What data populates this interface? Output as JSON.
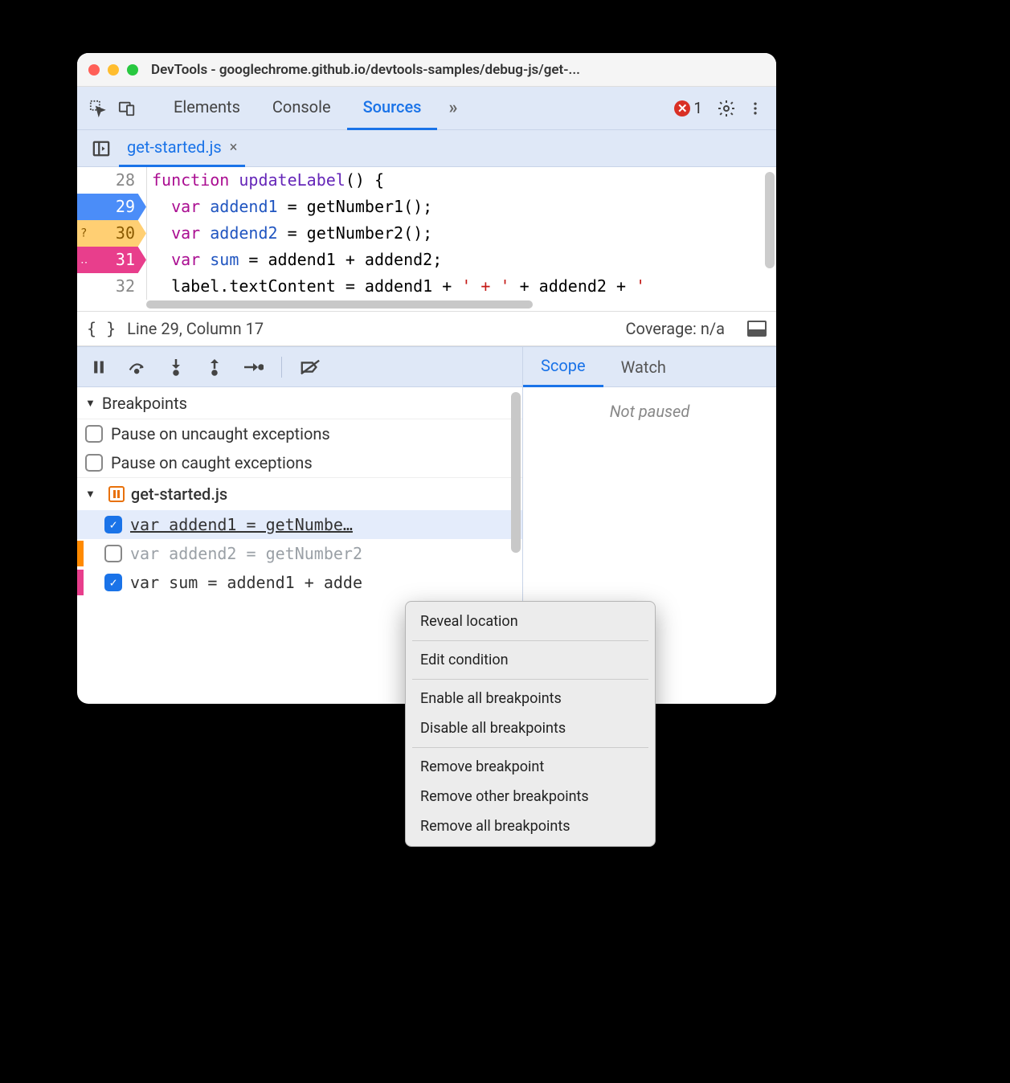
{
  "window": {
    "title": "DevTools - googlechrome.github.io/devtools-samples/debug-js/get-..."
  },
  "toolbar": {
    "tabs": [
      "Elements",
      "Console",
      "Sources"
    ],
    "active_tab": "Sources",
    "overflow": "»",
    "error_count": "1"
  },
  "file_tab": {
    "name": "get-started.js",
    "close": "×"
  },
  "code": {
    "lines": [
      {
        "num": "28",
        "bp": null,
        "indicator": "",
        "tokens": [
          [
            "kw",
            "function "
          ],
          [
            "fn",
            "updateLabel"
          ],
          [
            "",
            "() {"
          ]
        ]
      },
      {
        "num": "29",
        "bp": "blue",
        "indicator": "",
        "tokens": [
          [
            "",
            "  "
          ],
          [
            "kw",
            "var "
          ],
          [
            "varname",
            "addend1"
          ],
          [
            "",
            " = getNumber1();"
          ]
        ]
      },
      {
        "num": "30",
        "bp": "orange",
        "indicator": "?",
        "tokens": [
          [
            "",
            "  "
          ],
          [
            "kw",
            "var "
          ],
          [
            "varname",
            "addend2"
          ],
          [
            "",
            " = getNumber2();"
          ]
        ]
      },
      {
        "num": "31",
        "bp": "pink",
        "indicator": "‥",
        "tokens": [
          [
            "",
            "  "
          ],
          [
            "kw",
            "var "
          ],
          [
            "varname",
            "sum"
          ],
          [
            "",
            " = addend1 + addend2;"
          ]
        ]
      },
      {
        "num": "32",
        "bp": null,
        "indicator": "",
        "tokens": [
          [
            "",
            "  label.textContent = addend1 + "
          ],
          [
            "str",
            "' + '"
          ],
          [
            "",
            " + addend2 + "
          ],
          [
            "str",
            "'"
          ]
        ]
      }
    ]
  },
  "status": {
    "position": "Line 29, Column 17",
    "coverage": "Coverage: n/a"
  },
  "breakpoints": {
    "header": "Breakpoints",
    "pause_uncaught": "Pause on uncaught exceptions",
    "pause_caught": "Pause on caught exceptions",
    "file": "get-started.js",
    "items": [
      {
        "checked": true,
        "text": "var addend1 = getNumbe…",
        "stripe": null,
        "selected": true,
        "disabled": false
      },
      {
        "checked": false,
        "text": "var addend2 = getNumber2",
        "stripe": "orange",
        "selected": false,
        "disabled": true
      },
      {
        "checked": true,
        "text": "var sum = addend1 + adde",
        "stripe": "pink",
        "selected": false,
        "disabled": false
      }
    ]
  },
  "scope": {
    "tabs": [
      "Scope",
      "Watch"
    ],
    "active": "Scope",
    "not_paused": "Not paused"
  },
  "context_menu": {
    "items": [
      "Reveal location",
      "-",
      "Edit condition",
      "-",
      "Enable all breakpoints",
      "Disable all breakpoints",
      "-",
      "Remove breakpoint",
      "Remove other breakpoints",
      "Remove all breakpoints"
    ]
  }
}
